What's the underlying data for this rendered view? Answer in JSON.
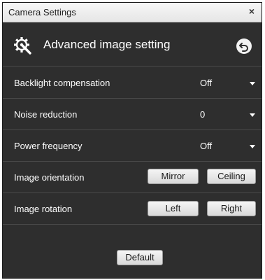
{
  "window": {
    "title": "Camera Settings",
    "close_glyph": "×"
  },
  "header": {
    "title": "Advanced image setting",
    "icon": "gear-wrench-icon",
    "back_icon": "undo-icon"
  },
  "settings": {
    "backlight": {
      "label": "Backlight compensation",
      "value": "Off"
    },
    "noise": {
      "label": "Noise reduction",
      "value": "0"
    },
    "power": {
      "label": "Power frequency",
      "value": "Off"
    },
    "orientation": {
      "label": "Image orientation",
      "mirror": "Mirror",
      "ceiling": "Ceiling"
    },
    "rotation": {
      "label": "Image rotation",
      "left": "Left",
      "right": "Right"
    }
  },
  "footer": {
    "default_label": "Default"
  },
  "colors": {
    "panel": "#2e2e2e",
    "divider": "#4a4a4a",
    "text": "#ffffff"
  }
}
